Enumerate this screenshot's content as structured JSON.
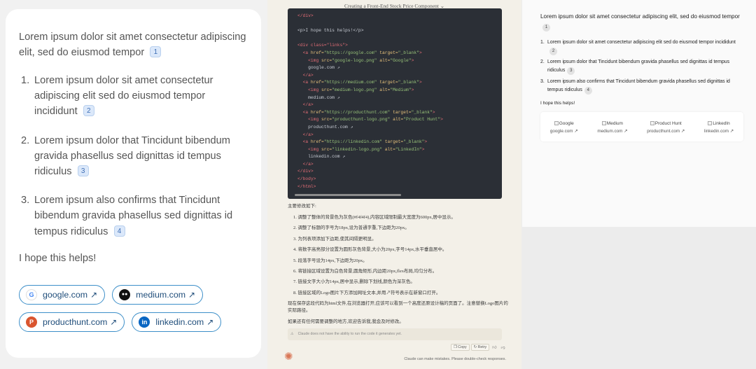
{
  "left": {
    "intro": "Lorem ipsum dolor sit amet consectetur adipiscing elit, sed do eiusmod tempor",
    "intro_cite": "1",
    "items": [
      {
        "num": "1.",
        "text": "Lorem ipsum dolor sit amet consectetur adipiscing elit sed do eiusmod tempor incididunt",
        "cite": "2"
      },
      {
        "num": "2.",
        "text": "Lorem ipsum dolor that Tincidunt bibendum gravida phasellus sed dignittas id tempus ridiculus",
        "cite": "3"
      },
      {
        "num": "3.",
        "text": "Lorem ipsum also confirms that Tincidunt bibendum gravida phasellus sed dignittas id tempus ridiculus",
        "cite": "4"
      }
    ],
    "closing": "I hope this helps!",
    "links": [
      {
        "label": "google.com",
        "icon_glyph": "G",
        "icon_color": "#ffffff",
        "arrow": "↗"
      },
      {
        "label": "medium.com",
        "icon_glyph": "●●",
        "icon_color": "#111111",
        "arrow": "↗"
      },
      {
        "label": "producthunt.com",
        "icon_glyph": "P",
        "icon_color": "#da552f",
        "arrow": "↗"
      },
      {
        "label": "linkedin.com",
        "icon_glyph": "in",
        "icon_color": "#0a66c2",
        "arrow": "↗"
      }
    ]
  },
  "middle": {
    "title": "Creating a Front-End Stock Price Component ⌄",
    "summary_heading": "主要修改如下:",
    "changes": [
      "1. 调整了整体的背景色为灰色(#f4f4f4),内容区域限制最大宽度为600px,居中显示。",
      "2. 调整了标题的字号为18px,设为普通字重,下边距为20px。",
      "3. 为列表项添加下边距,使其间隔更明显。",
      "4. 将数字高亮部分设置为圆形灰色背景,大小为20px,字号14px,水平垂直居中。",
      "5. 段落字号设为14px,下边距为20px。",
      "6. 将链接区域设置为白色背景,圆角矩形,内边距20px,flex布局,均匀分布。",
      "7. 链接文字大小为14px,居中显示,删除下划线,颜色为深灰色。",
      "8. 链接区域的Logo图片下方添加网址文本,并用↗符号表示在新窗口打开。"
    ],
    "note": "现在保存这段代码为html文件,在浏览器打开,应该可以看到一个高度还原设计稿的页面了。注意替换Logo图片的实际路径。",
    "followup": "如果还有任何需要调整的地方,欢迎告诉我,我会及时修改。",
    "warning": "Claude does not have the ability to run the code it generates yet.",
    "copy_label": "Copy",
    "retry_label": "Retry",
    "disclaimer": "Claude can make mistakes. Please double-check responses."
  },
  "code": {
    "closing_div": "</div>",
    "hope_line": "<p>I hope this helps!</p>",
    "links_open": "<div class=\"links\">",
    "links": [
      {
        "href": "https://google.com",
        "src": "google-logo.png",
        "alt": "Google",
        "text": "google.com ↗"
      },
      {
        "href": "https://medium.com",
        "src": "medium-logo.png",
        "alt": "Medium",
        "text": "medium.com ↗"
      },
      {
        "href": "https://producthunt.com",
        "src": "producthunt-logo.png",
        "alt": "Product Hunt",
        "text": "producthunt.com ↗"
      },
      {
        "href": "https://linkedin.com",
        "src": "linkedin-logo.png",
        "alt": "LinkedIn",
        "text": "linkedin.com ↗"
      }
    ],
    "close_div": "</div>",
    "close_body": "</body>",
    "close_html": "</html>"
  },
  "right": {
    "intro": "Lorem ipsum dolor sit amet consectetur adipiscing elit, sed do eiusmod tempor",
    "intro_cite": "1",
    "items": [
      {
        "num": "1.",
        "text": "Lorem ipsum dolor sit amet consectetur adipiscing elit sed do eiusmod tempor incididunt",
        "cite": "2"
      },
      {
        "num": "2.",
        "text": "Lorem ipsum dolor that Tincidunt bibendum gravida phasellus sed dignittas id tempus ridiculus",
        "cite": "3"
      },
      {
        "num": "3.",
        "text": "Lorem ipsum also confirms that Tincidunt bibendum gravida phasellus sed dignittas id tempus ridiculus",
        "cite": "4"
      }
    ],
    "closing": "I hope this helps!",
    "links": [
      {
        "alt": "Google",
        "text": "google.com ↗"
      },
      {
        "alt": "Medium",
        "text": "medium.com ↗"
      },
      {
        "alt": "Product Hunt",
        "text": "producthunt.com ↗"
      },
      {
        "alt": "LinkedIn",
        "text": "linkedin.com ↗"
      }
    ]
  }
}
